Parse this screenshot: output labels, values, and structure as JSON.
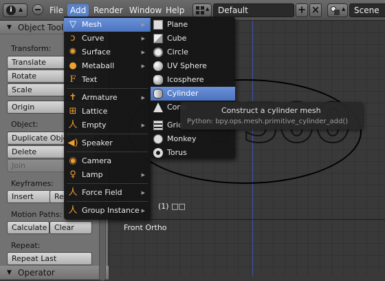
{
  "header": {
    "menus": [
      "File",
      "Add",
      "Render",
      "Window",
      "Help"
    ],
    "active_menu": "Add",
    "layout_name": "Default",
    "scene_name": "Scene",
    "add_label": "+",
    "close_label": "×"
  },
  "toolshelf": {
    "title": "Object Tools",
    "transform_label": "Transform:",
    "translate": "Translate",
    "rotate": "Rotate",
    "scale": "Scale",
    "origin": "Origin",
    "object_label": "Object:",
    "duplicate": "Duplicate Objects",
    "delete": "Delete",
    "join": "Join",
    "keyframes_label": "Keyframes:",
    "insert": "Insert",
    "remove": "Remove",
    "motion_paths_label": "Motion Paths:",
    "calculate": "Calculate",
    "clear": "Clear",
    "repeat_label": "Repeat:",
    "repeat_last": "Repeat Last",
    "operator_title": "Operator"
  },
  "viewport": {
    "view_label": "Front Ortho",
    "object_label": "(1) □□",
    "object_text": "7500"
  },
  "add_menu": [
    {
      "label": "Mesh",
      "icon": "mesh-icon",
      "submenu": true,
      "active": true
    },
    {
      "label": "Curve",
      "icon": "curve-icon",
      "submenu": true
    },
    {
      "label": "Surface",
      "icon": "surface-icon",
      "submenu": true
    },
    {
      "label": "Metaball",
      "icon": "metaball-icon",
      "submenu": true
    },
    {
      "label": "Text",
      "icon": "text-icon",
      "submenu": false
    },
    {
      "label": "Armature",
      "icon": "armature-icon",
      "submenu": true
    },
    {
      "label": "Lattice",
      "icon": "lattice-icon",
      "submenu": false
    },
    {
      "label": "Empty",
      "icon": "empty-icon",
      "submenu": true
    },
    {
      "label": "Speaker",
      "icon": "speaker-icon",
      "submenu": false
    },
    {
      "label": "Camera",
      "icon": "camera-icon",
      "submenu": false
    },
    {
      "label": "Lamp",
      "icon": "lamp-icon",
      "submenu": true
    },
    {
      "label": "Force Field",
      "icon": "force-field-icon",
      "submenu": true
    },
    {
      "label": "Group Instance",
      "icon": "group-instance-icon",
      "submenu": true
    }
  ],
  "mesh_menu": [
    {
      "label": "Plane",
      "icon": "plane-icon"
    },
    {
      "label": "Cube",
      "icon": "cube-icon"
    },
    {
      "label": "Circle",
      "icon": "circle-icon"
    },
    {
      "label": "UV Sphere",
      "icon": "uv-sphere-icon"
    },
    {
      "label": "Icosphere",
      "icon": "icosphere-icon"
    },
    {
      "label": "Cylinder",
      "icon": "cylinder-icon",
      "active": true
    },
    {
      "label": "Cone",
      "icon": "cone-icon"
    },
    {
      "label": "Grid",
      "icon": "grid-icon"
    },
    {
      "label": "Monkey",
      "icon": "monkey-icon"
    },
    {
      "label": "Torus",
      "icon": "torus-icon"
    }
  ],
  "tooltip": {
    "description": "Construct a cylinder mesh",
    "python": "Python: bpy.ops.mesh.primitive_cylinder_add()"
  },
  "colors": {
    "highlight": "#5a82c9",
    "axis_blue": "#3f4fb3",
    "menu_bg": "#161616"
  }
}
